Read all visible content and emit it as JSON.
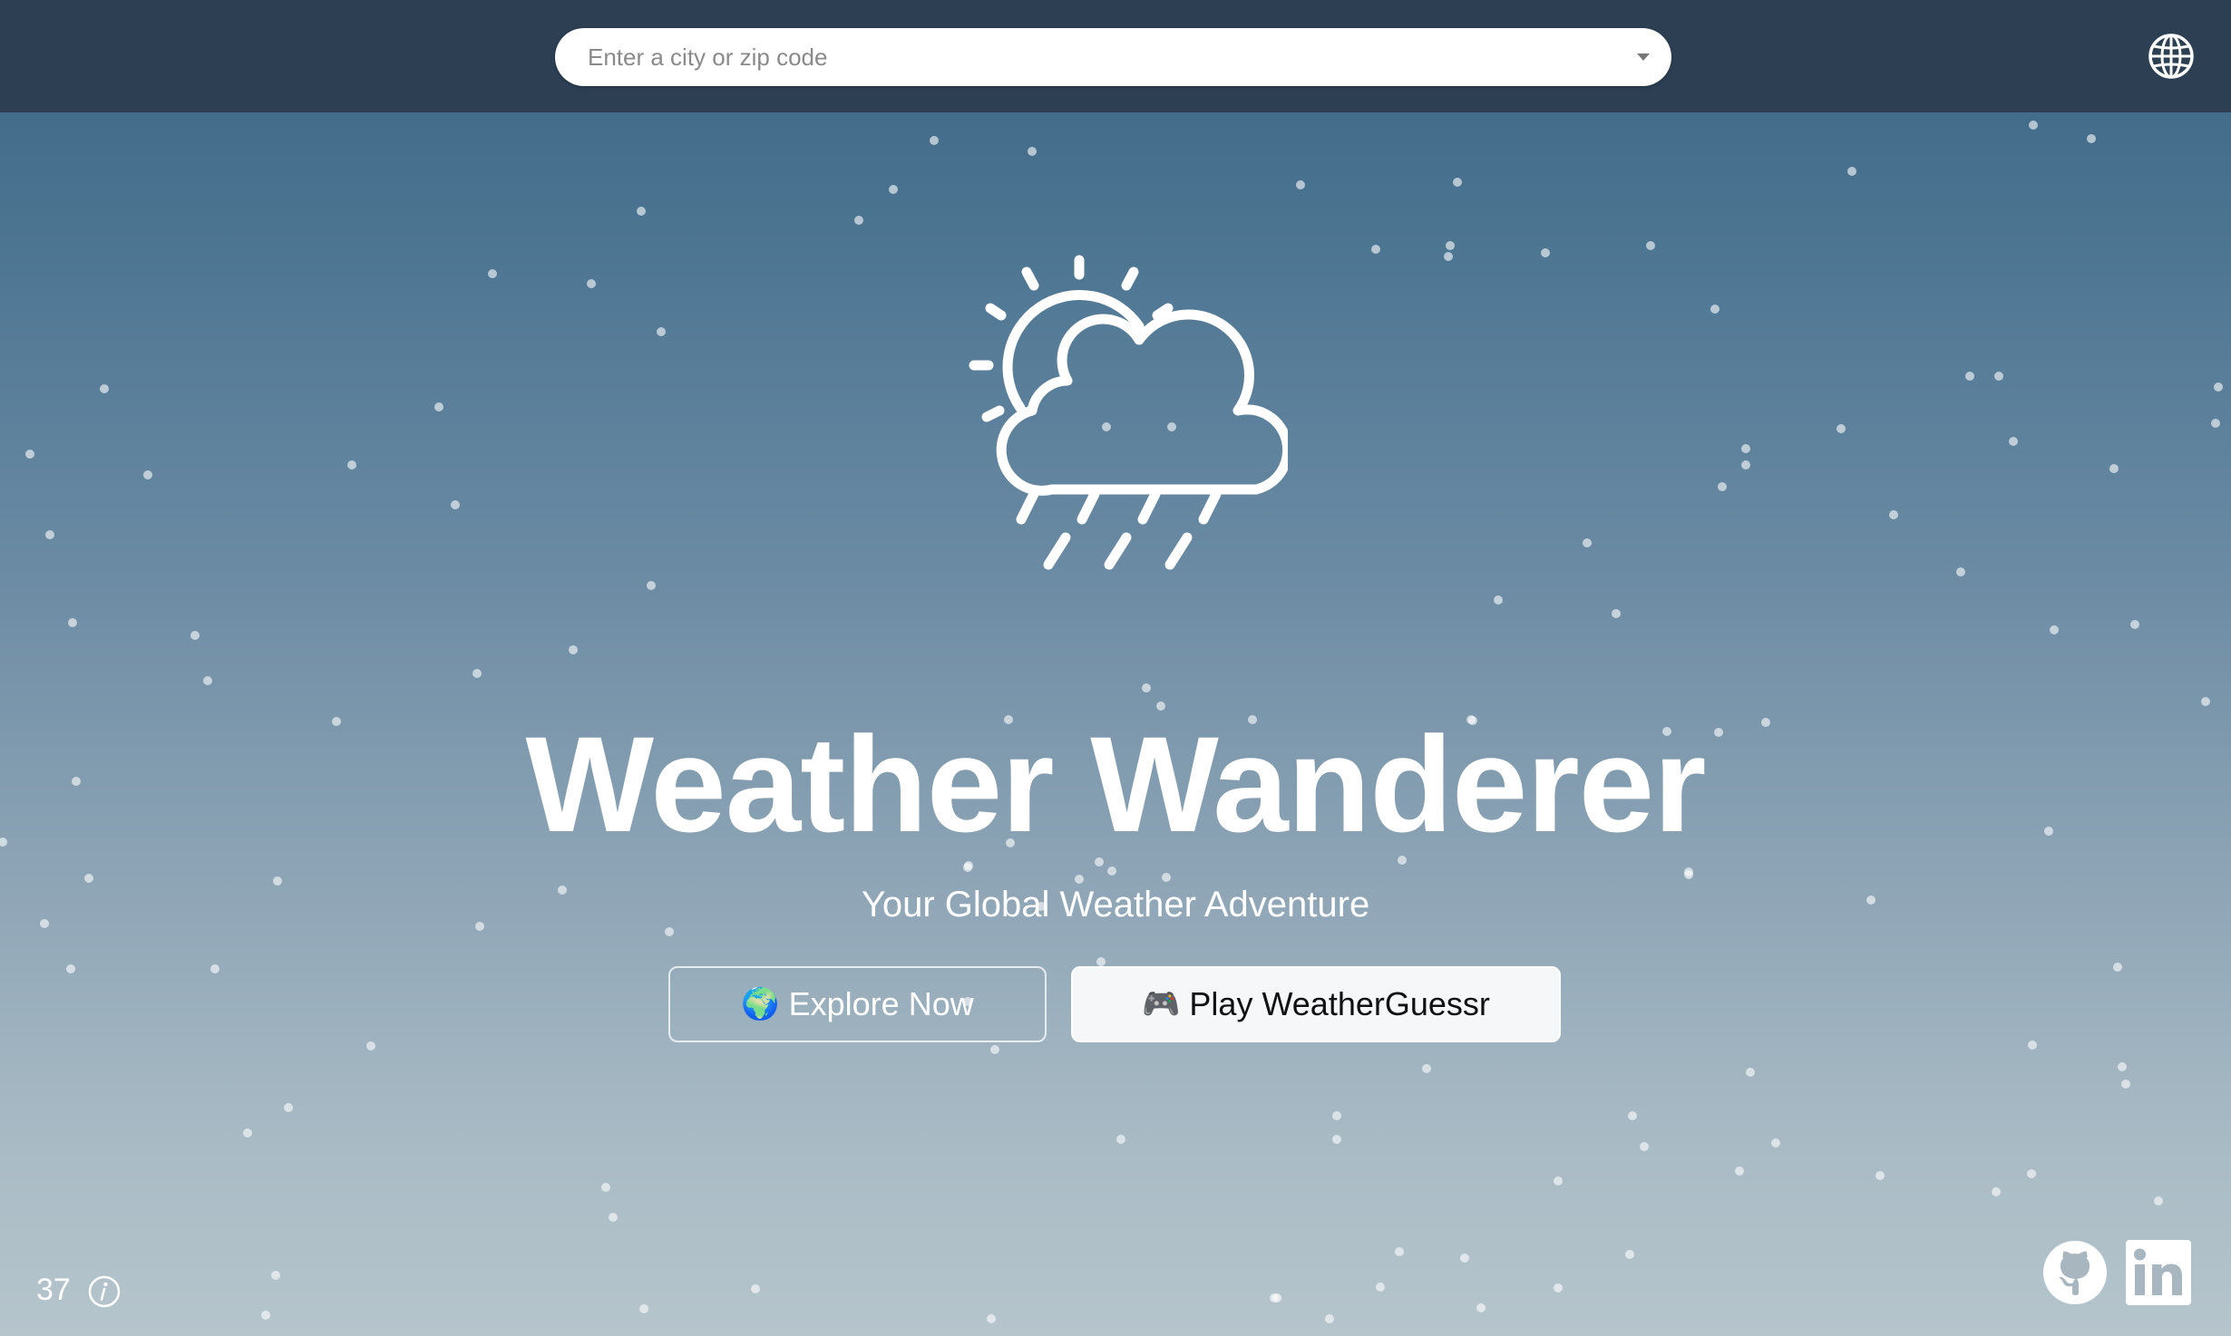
{
  "search": {
    "placeholder": "Enter a city or zip code",
    "value": ""
  },
  "hero": {
    "title": "Weather Wanderer",
    "subtitle": "Your Global Weather Adventure",
    "icon": "sun-cloud-rain-icon"
  },
  "buttons": {
    "explore": {
      "emoji": "🌍",
      "label": "Explore Now"
    },
    "play": {
      "emoji": "🎮",
      "label": "Play WeatherGuessr"
    }
  },
  "footer": {
    "count": "37",
    "info_icon": "info-icon",
    "links": [
      "github-icon",
      "linkedin-icon"
    ]
  },
  "colors": {
    "topbar": "#2c3f53",
    "gradient_top": "#3b6585",
    "gradient_bottom": "#b6c5cc",
    "text": "#ffffff",
    "play_button_bg": "#f6f7f9"
  }
}
